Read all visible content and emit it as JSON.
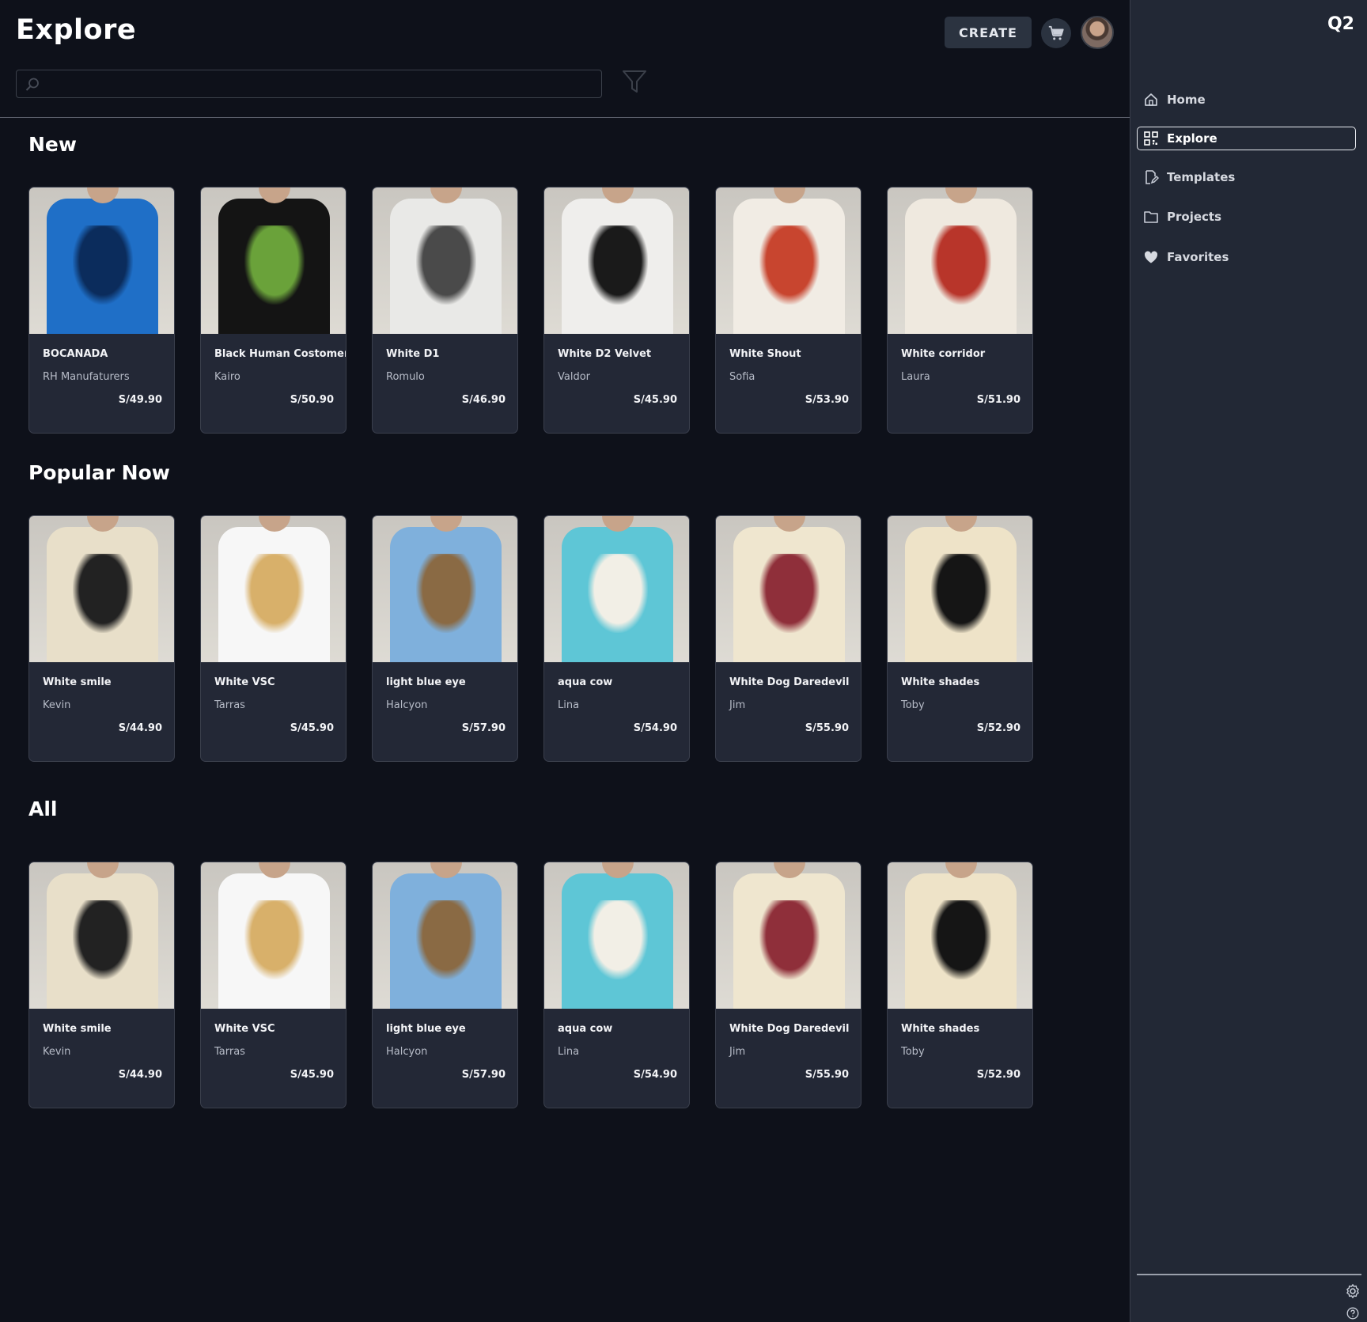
{
  "header": {
    "title": "Explore",
    "create_label": "CREATE",
    "search_placeholder": ""
  },
  "sidebar": {
    "brand": "Q2",
    "items": [
      {
        "label": "Home",
        "icon": "home-icon"
      },
      {
        "label": "Explore",
        "icon": "grid-qr-icon",
        "active": true
      },
      {
        "label": "Templates",
        "icon": "edit-doc-icon"
      },
      {
        "label": "Projects",
        "icon": "folder-icon"
      },
      {
        "label": "Favorites",
        "icon": "heart-icon"
      }
    ]
  },
  "sections": [
    {
      "title": "New",
      "products": [
        {
          "name": "BOCANADA",
          "maker": "RH Manufaturers",
          "price": "S/49.90",
          "shirt": "#1f6fc7",
          "print": "#0b2c5c"
        },
        {
          "name": "Black Human Costomer",
          "maker": "Kairo",
          "price": "S/50.90",
          "shirt": "#141414",
          "print": "#6aa23a"
        },
        {
          "name": "White D1",
          "maker": "Romulo",
          "price": "S/46.90",
          "shirt": "#e9e9e7",
          "print": "#4a4a4a"
        },
        {
          "name": "White D2 Velvet",
          "maker": "Valdor",
          "price": "S/45.90",
          "shirt": "#efeeec",
          "print": "#1a1a1a"
        },
        {
          "name": "White Shout",
          "maker": "Sofia",
          "price": "S/53.90",
          "shirt": "#f1ece4",
          "print": "#c8452f"
        },
        {
          "name": "White corridor",
          "maker": "Laura",
          "price": "S/51.90",
          "shirt": "#efe9df",
          "print": "#b8352a"
        }
      ]
    },
    {
      "title": "Popular Now",
      "products": [
        {
          "name": "White smile",
          "maker": "Kevin",
          "price": "S/44.90",
          "shirt": "#e8dfc9",
          "print": "#222222"
        },
        {
          "name": "White VSC",
          "maker": "Tarras",
          "price": "S/45.90",
          "shirt": "#f7f7f7",
          "print": "#d8b06a"
        },
        {
          "name": "light blue eye",
          "maker": "Halcyon",
          "price": "S/57.90",
          "shirt": "#7fb0dc",
          "print": "#8a6a44"
        },
        {
          "name": "aqua cow",
          "maker": "Lina",
          "price": "S/54.90",
          "shirt": "#5ec6d6",
          "print": "#f2efe6"
        },
        {
          "name": "White Dog Daredevil",
          "maker": "Jim",
          "price": "S/55.90",
          "shirt": "#efe6cf",
          "print": "#8f2f3a"
        },
        {
          "name": "White shades",
          "maker": "Toby",
          "price": "S/52.90",
          "shirt": "#eee3c8",
          "print": "#151515"
        }
      ]
    },
    {
      "title": "All",
      "products": [
        {
          "name": "White smile",
          "maker": "Kevin",
          "price": "S/44.90",
          "shirt": "#e8dfc9",
          "print": "#222222"
        },
        {
          "name": "White VSC",
          "maker": "Tarras",
          "price": "S/45.90",
          "shirt": "#f7f7f7",
          "print": "#d8b06a"
        },
        {
          "name": "light blue eye",
          "maker": "Halcyon",
          "price": "S/57.90",
          "shirt": "#7fb0dc",
          "print": "#8a6a44"
        },
        {
          "name": "aqua cow",
          "maker": "Lina",
          "price": "S/54.90",
          "shirt": "#5ec6d6",
          "print": "#f2efe6"
        },
        {
          "name": "White Dog Daredevil",
          "maker": "Jim",
          "price": "S/55.90",
          "shirt": "#efe6cf",
          "print": "#8f2f3a"
        },
        {
          "name": "White shades",
          "maker": "Toby",
          "price": "S/52.90",
          "shirt": "#eee3c8",
          "print": "#151515"
        }
      ]
    }
  ]
}
